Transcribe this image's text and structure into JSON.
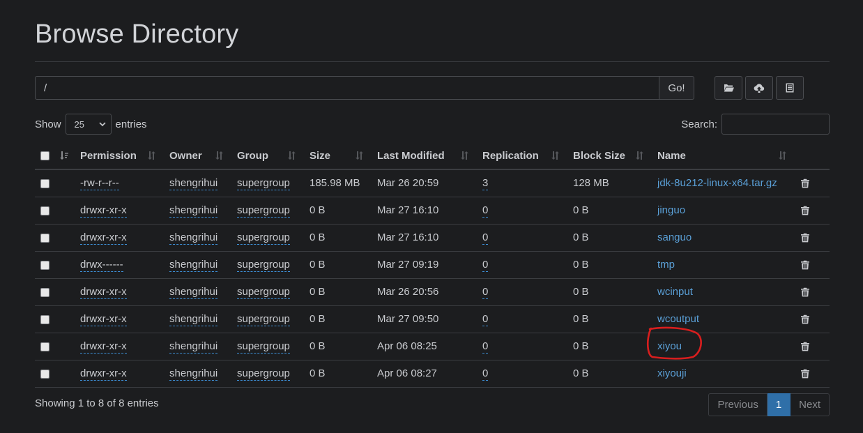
{
  "page": {
    "title": "Browse Directory"
  },
  "pathbar": {
    "value": "/",
    "go_label": "Go!"
  },
  "toolbar": {
    "icons": [
      "folder-open-icon",
      "cloud-upload-icon",
      "list-icon"
    ]
  },
  "length": {
    "show_label": "Show",
    "selected": "25",
    "entries_label": "entries"
  },
  "search": {
    "label": "Search:",
    "value": ""
  },
  "table": {
    "columns": [
      "Permission",
      "Owner",
      "Group",
      "Size",
      "Last Modified",
      "Replication",
      "Block Size",
      "Name"
    ],
    "rows": [
      {
        "permission": "-rw-r--r--",
        "owner": "shengrihui",
        "group": "supergroup",
        "size": "185.98 MB",
        "modified": "Mar 26 20:59",
        "replication": "3",
        "block_size": "128 MB",
        "name": "jdk-8u212-linux-x64.tar.gz"
      },
      {
        "permission": "drwxr-xr-x",
        "owner": "shengrihui",
        "group": "supergroup",
        "size": "0 B",
        "modified": "Mar 27 16:10",
        "replication": "0",
        "block_size": "0 B",
        "name": "jinguo"
      },
      {
        "permission": "drwxr-xr-x",
        "owner": "shengrihui",
        "group": "supergroup",
        "size": "0 B",
        "modified": "Mar 27 16:10",
        "replication": "0",
        "block_size": "0 B",
        "name": "sanguo"
      },
      {
        "permission": "drwx------",
        "owner": "shengrihui",
        "group": "supergroup",
        "size": "0 B",
        "modified": "Mar 27 09:19",
        "replication": "0",
        "block_size": "0 B",
        "name": "tmp"
      },
      {
        "permission": "drwxr-xr-x",
        "owner": "shengrihui",
        "group": "supergroup",
        "size": "0 B",
        "modified": "Mar 26 20:56",
        "replication": "0",
        "block_size": "0 B",
        "name": "wcinput"
      },
      {
        "permission": "drwxr-xr-x",
        "owner": "shengrihui",
        "group": "supergroup",
        "size": "0 B",
        "modified": "Mar 27 09:50",
        "replication": "0",
        "block_size": "0 B",
        "name": "wcoutput"
      },
      {
        "permission": "drwxr-xr-x",
        "owner": "shengrihui",
        "group": "supergroup",
        "size": "0 B",
        "modified": "Apr 06 08:25",
        "replication": "0",
        "block_size": "0 B",
        "name": "xiyou"
      },
      {
        "permission": "drwxr-xr-x",
        "owner": "shengrihui",
        "group": "supergroup",
        "size": "0 B",
        "modified": "Apr 06 08:27",
        "replication": "0",
        "block_size": "0 B",
        "name": "xiyouji"
      }
    ]
  },
  "footer": {
    "info": "Showing 1 to 8 of 8 entries",
    "previous": "Previous",
    "current_page": "1",
    "next": "Next"
  },
  "colors": {
    "background": "#1c1d1f",
    "link": "#5a9fd6",
    "active_page": "#2f6fa8",
    "annotation": "#d81e1e"
  }
}
